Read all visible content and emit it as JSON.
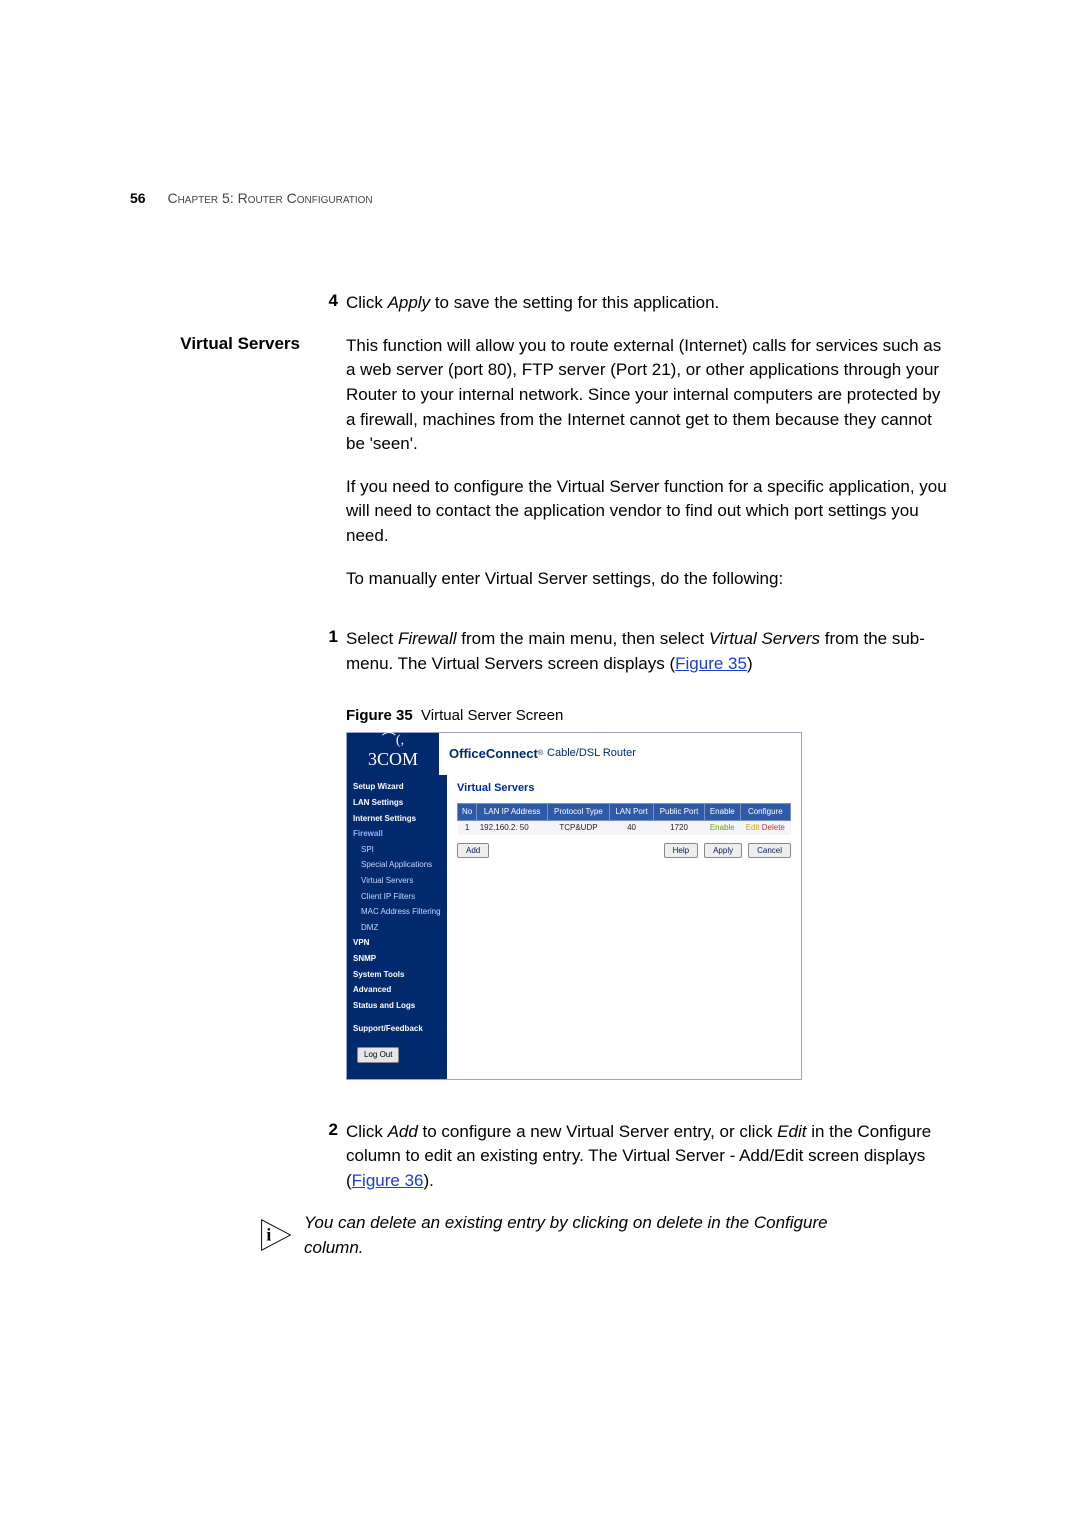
{
  "header": {
    "page_number": "56",
    "chapter_label": "Chapter 5: Router Configuration"
  },
  "step4": {
    "num": "4",
    "pre": "Click ",
    "em": "Apply",
    "post": " to save the setting for this application."
  },
  "virtual_servers_heading": "Virtual Servers",
  "vs_para1": "This function will allow you to route external (Internet) calls for services such as a web server (port 80), FTP server (Port 21), or other applications through your Router to your internal network. Since your internal computers are protected by a firewall, machines from the Internet cannot get to them because they cannot be 'seen'.",
  "vs_para2": "If you need to configure the Virtual Server function for a specific application, you will need to contact the application vendor to find out which port settings you need.",
  "vs_para3": "To manually enter Virtual Server settings, do the following:",
  "step1": {
    "num": "1",
    "pre": "Select ",
    "em1": "Firewall",
    "mid": " from the main menu, then select ",
    "em2": "Virtual Servers",
    "post": " from the sub-menu. The Virtual Servers screen displays (",
    "link": "Figure 35",
    "close": ")"
  },
  "figure35": {
    "label": "Figure 35",
    "caption": "Virtual Server Screen"
  },
  "router_ui": {
    "brand": "3COM",
    "product_bold": "OfficeConnect",
    "product_sub": " Cable/DSL Router",
    "main_title": "Virtual Servers",
    "nav": [
      {
        "label": "Setup Wizard",
        "cls": "top"
      },
      {
        "label": "LAN Settings",
        "cls": "top"
      },
      {
        "label": "Internet Settings",
        "cls": "top"
      },
      {
        "label": "Firewall",
        "cls": "top active"
      },
      {
        "label": "SPI",
        "cls": "sub"
      },
      {
        "label": "Special Applications",
        "cls": "sub"
      },
      {
        "label": "Virtual Servers",
        "cls": "sub"
      },
      {
        "label": "Client IP Filters",
        "cls": "sub"
      },
      {
        "label": "MAC Address Filtering",
        "cls": "sub"
      },
      {
        "label": "DMZ",
        "cls": "sub"
      },
      {
        "label": "VPN",
        "cls": "top"
      },
      {
        "label": "SNMP",
        "cls": "top"
      },
      {
        "label": "System Tools",
        "cls": "top"
      },
      {
        "label": "Advanced",
        "cls": "top"
      },
      {
        "label": "Status and Logs",
        "cls": "top"
      },
      {
        "label": "Support/Feedback",
        "cls": "top",
        "gap": true
      }
    ],
    "logout_label": "Log Out",
    "table": {
      "headers": [
        "No",
        "LAN IP Address",
        "Protocol Type",
        "LAN Port",
        "Public Port",
        "Enable",
        "Configure"
      ],
      "row": {
        "no": "1",
        "ip": "192.160.2. 50",
        "proto": "TCP&UDP",
        "lanport": "40",
        "pubport": "1720",
        "enable": "Enable",
        "cfg_edit": "Edit",
        "cfg_del": "Delete"
      }
    },
    "buttons": {
      "add": "Add",
      "help": "Help",
      "apply": "Apply",
      "cancel": "Cancel"
    }
  },
  "step2": {
    "num": "2",
    "pre": "Click ",
    "em1": "Add",
    "mid": " to configure a new Virtual Server entry, or click ",
    "em2": "Edit",
    "post": " in the Configure column to edit an existing entry. The Virtual Server - Add/Edit screen displays (",
    "link": "Figure 36",
    "close": ")."
  },
  "note": "You can delete an existing entry by clicking on delete in the Configure column."
}
